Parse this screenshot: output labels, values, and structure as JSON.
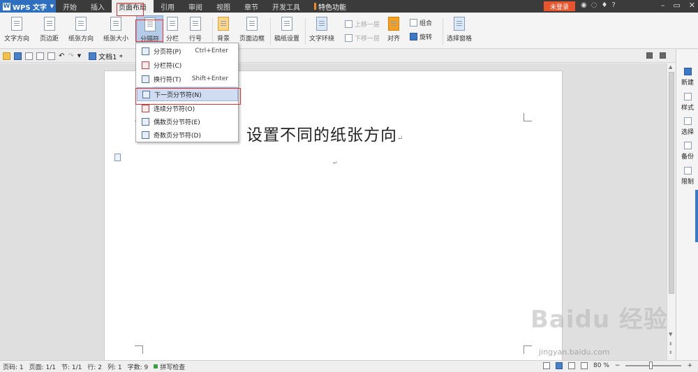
{
  "app": {
    "name": "WPS 文字",
    "login_label": "未登录"
  },
  "menu_tabs": [
    {
      "label": "开始"
    },
    {
      "label": "插入"
    },
    {
      "label": "页面布局"
    },
    {
      "label": "引用"
    },
    {
      "label": "审阅"
    },
    {
      "label": "视图"
    },
    {
      "label": "章节"
    },
    {
      "label": "开发工具"
    },
    {
      "label": "特色功能"
    }
  ],
  "active_tab": "页面布局",
  "help_label": "?",
  "ribbon": {
    "text_direction": "文字方向",
    "margins": "页边距",
    "orientation": "纸张方向",
    "size": "纸张大小",
    "breaks": "分隔符",
    "columns": "分栏",
    "line_numbers": "行号",
    "background": "背景",
    "page_border": "页面边框",
    "paper_setup": "稿纸设置",
    "text_wrap": "文字环绕",
    "bring_forward": "上移一层",
    "send_backward": "下移一层",
    "align": "对齐",
    "group": "组合",
    "rotate": "旋转",
    "selection_pane": "选择窗格"
  },
  "document": {
    "tab_name": "文档1 *",
    "heading": "设置不同的纸张方向",
    "para_mark": "↵"
  },
  "dropdown": {
    "items": [
      {
        "label": "分页符(P)",
        "shortcut": "Ctrl+Enter"
      },
      {
        "label": "分栏符(C)",
        "shortcut": ""
      },
      {
        "label": "换行符(T)",
        "shortcut": "Shift+Enter"
      },
      {
        "label": "下一页分节符(N)",
        "shortcut": ""
      },
      {
        "label": "连续分节符(O)",
        "shortcut": ""
      },
      {
        "label": "偶数页分节符(E)",
        "shortcut": ""
      },
      {
        "label": "奇数页分节符(D)",
        "shortcut": ""
      }
    ],
    "selected": "下一页分节符(N)"
  },
  "taskpane": {
    "items": [
      {
        "label": "新建"
      },
      {
        "label": "样式"
      },
      {
        "label": "选择"
      },
      {
        "label": "备份"
      },
      {
        "label": "限制"
      }
    ]
  },
  "statusbar": {
    "page_code": "页码: 1",
    "page": "页面: 1/1",
    "section": "节: 1/1",
    "row": "行: 2",
    "col": "列: 1",
    "word_count": "字数: 9",
    "spell_check": "拼写检查",
    "zoom": "80 %",
    "zoom_level": 0.45
  },
  "watermark": {
    "main": "Baidu 经验",
    "sub": "jingyan.baidu.com"
  }
}
